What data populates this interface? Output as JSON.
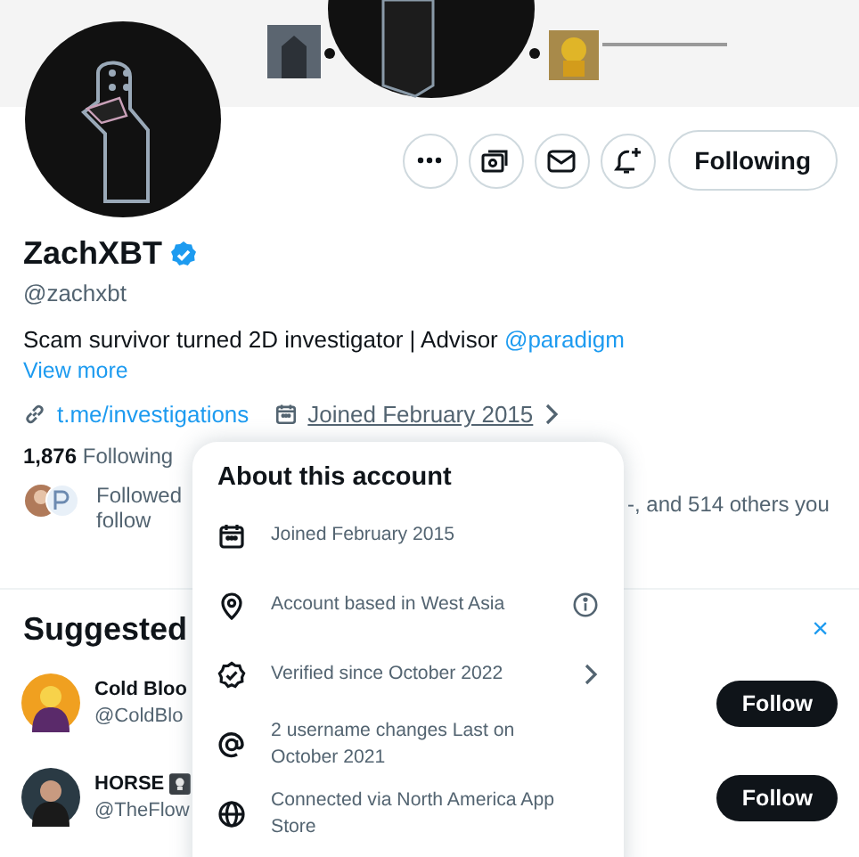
{
  "profile": {
    "name": "ZachXBT",
    "verified": true,
    "handle": "@zachxbt",
    "bio": "Scam survivor turned 2D investigator | Advisor",
    "bio_link": "@paradigm",
    "view_more": "View more",
    "website": "t.me/investigations",
    "joined": "Joined February 2015",
    "following_count": "1,876",
    "following_label": "Following",
    "followed_by_left": "Followed",
    "followed_by_right": "-, and 514 others you",
    "followed_by_end": "follow"
  },
  "actions": [
    {
      "kind": "more"
    },
    {
      "kind": "subscribe"
    },
    {
      "kind": "message"
    },
    {
      "kind": "notify"
    }
  ],
  "follow_button": {
    "label": "Following"
  },
  "suggested": {
    "title": "Suggested",
    "close": "×",
    "accounts": [
      {
        "name": "Cold Bloo",
        "handle": "@ColdBlo",
        "button": "Follow",
        "badge": false
      },
      {
        "name": "HORSE",
        "handle": "@TheFlow",
        "button": "Follow",
        "badge": true
      }
    ]
  },
  "popup": {
    "title": "About this account",
    "items": [
      {
        "kind": "joined",
        "text": "Joined February 2015"
      },
      {
        "kind": "location",
        "text": "Account based in West Asia"
      },
      {
        "kind": "verified",
        "text": "Verified since October 2022"
      },
      {
        "kind": "username",
        "text": "2 username changes Last on October 2021"
      },
      {
        "kind": "connection",
        "text": "Connected via North America App Store"
      }
    ]
  }
}
